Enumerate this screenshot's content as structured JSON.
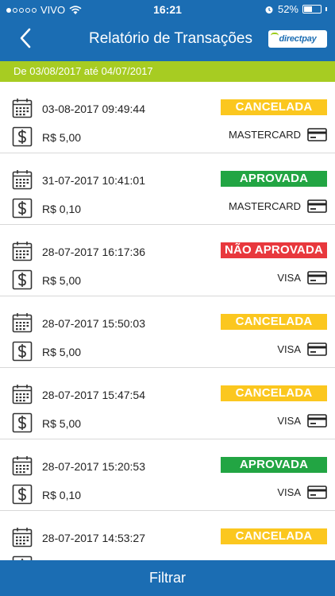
{
  "status": {
    "carrier": "VIVO",
    "time": "16:21",
    "battery": "52%",
    "battery_level": 0.52
  },
  "header": {
    "title": "Relatório de Transações",
    "logo": "directpay"
  },
  "date_range": "De 03/08/2017 até 04/07/2017",
  "colors": {
    "header": "#1b6db3",
    "date_bar": "#a7cc22",
    "cancelada": "#fbc71f",
    "aprovada": "#22a543",
    "nao_aprovada": "#e8383d"
  },
  "transactions": [
    {
      "datetime": "03-08-2017 09:49:44",
      "status": "CANCELADA",
      "status_color": "#fbc71f",
      "amount": "R$ 5,00",
      "brand": "MASTERCARD"
    },
    {
      "datetime": "31-07-2017 10:41:01",
      "status": "APROVADA",
      "status_color": "#22a543",
      "amount": "R$ 0,10",
      "brand": "MASTERCARD"
    },
    {
      "datetime": "28-07-2017 16:17:36",
      "status": "NÃO APROVADA",
      "status_color": "#e8383d",
      "amount": "R$ 5,00",
      "brand": "VISA"
    },
    {
      "datetime": "28-07-2017 15:50:03",
      "status": "CANCELADA",
      "status_color": "#fbc71f",
      "amount": "R$ 5,00",
      "brand": "VISA"
    },
    {
      "datetime": "28-07-2017 15:47:54",
      "status": "CANCELADA",
      "status_color": "#fbc71f",
      "amount": "R$ 5,00",
      "brand": "VISA"
    },
    {
      "datetime": "28-07-2017 15:20:53",
      "status": "APROVADA",
      "status_color": "#22a543",
      "amount": "R$ 0,10",
      "brand": "VISA"
    },
    {
      "datetime": "28-07-2017 14:53:27",
      "status": "CANCELADA",
      "status_color": "#fbc71f",
      "amount": "",
      "brand": ""
    }
  ],
  "footer": {
    "filter_label": "Filtrar"
  }
}
